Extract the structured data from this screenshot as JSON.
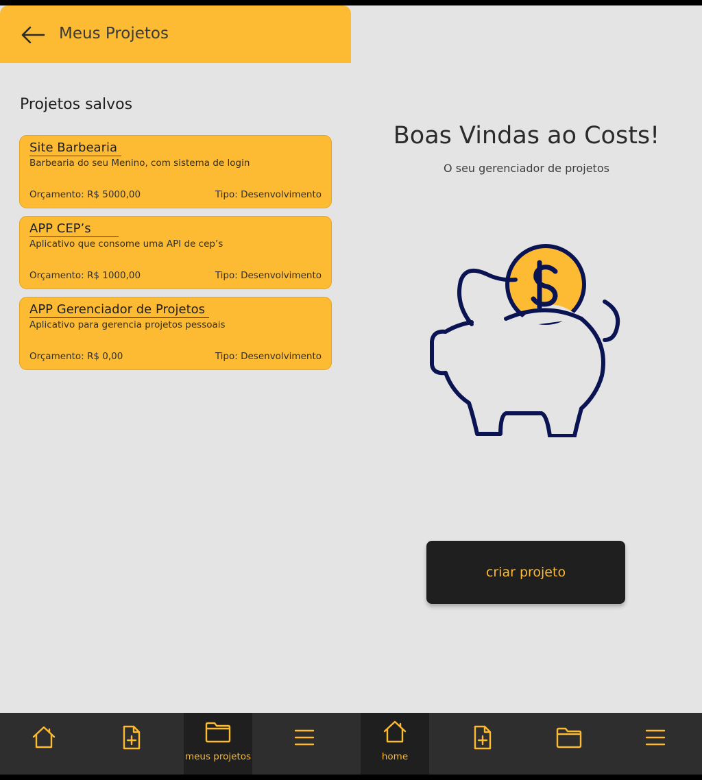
{
  "left_screen": {
    "header": {
      "title": "Meus Projetos",
      "back_icon": "arrow-left-icon"
    },
    "section_title": "Projetos salvos",
    "projects": [
      {
        "name": "Site Barbearia",
        "description": "Barbearia do seu Menino, com sistema de login",
        "budget": "Orçamento: R$ 5000,00",
        "type": "Tipo: Desenvolvimento"
      },
      {
        "name": "APP CEP’s",
        "description": "Aplicativo que consome uma API de cep’s",
        "budget": "Orçamento: R$ 1000,00",
        "type": "Tipo: Desenvolvimento"
      },
      {
        "name": "APP Gerenciador de Projetos",
        "description": "Aplicativo para gerencia projetos pessoais",
        "budget": "Orçamento: R$ 0,00",
        "type": "Tipo: Desenvolvimento"
      }
    ],
    "nav": {
      "active": "meus projetos",
      "items": [
        {
          "icon": "home-icon",
          "label": ""
        },
        {
          "icon": "file-plus-icon",
          "label": ""
        },
        {
          "icon": "folder-icon",
          "label": "meus projetos"
        },
        {
          "icon": "menu-icon",
          "label": ""
        }
      ]
    }
  },
  "right_screen": {
    "title": "Boas Vindas ao Costs!",
    "subtitle": "O seu gerenciador de projetos",
    "illustration": "piggy-bank-coin-icon",
    "create_button_label": "criar projeto",
    "nav": {
      "active": "home",
      "items": [
        {
          "icon": "home-icon",
          "label": "home"
        },
        {
          "icon": "file-plus-icon",
          "label": ""
        },
        {
          "icon": "folder-icon",
          "label": ""
        },
        {
          "icon": "menu-icon",
          "label": ""
        }
      ]
    }
  },
  "colors": {
    "accent": "#fdbb34",
    "dark": "#1f1f1f",
    "nav_bg": "#2e2e2e",
    "background": "#e4e4e4",
    "illustration_stroke": "#0b1452"
  }
}
